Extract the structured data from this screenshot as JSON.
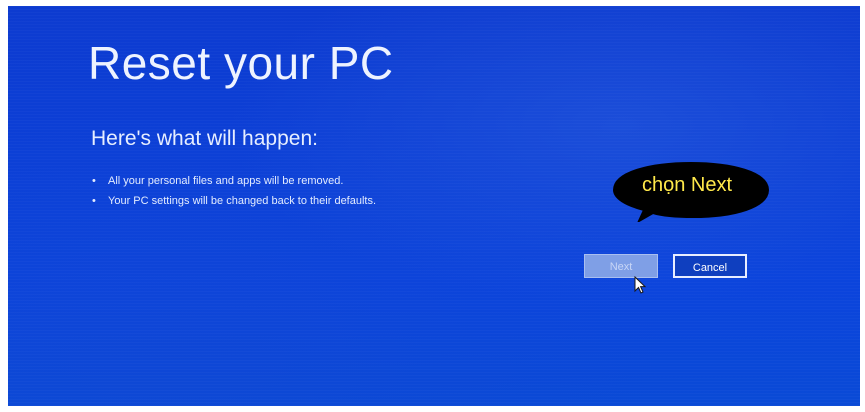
{
  "screen": {
    "title": "Reset your PC",
    "subtitle": "Here's what will happen:",
    "bullets": [
      "All your personal files and apps will be removed.",
      "Your PC settings will be changed back to their defaults."
    ],
    "buttons": {
      "next_label": "Next",
      "cancel_label": "Cancel"
    }
  },
  "annotation": {
    "callout_text": "chọn Next"
  },
  "colors": {
    "background": "#0c3fd6",
    "text": "#eef3ff",
    "next_button": "#7f9fe6",
    "callout_text": "#ffe94a",
    "callout_fill": "#000000"
  },
  "icons": {
    "pointer": "mouse-pointer-icon"
  }
}
